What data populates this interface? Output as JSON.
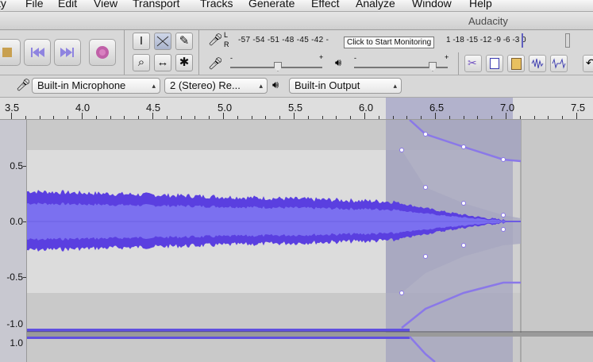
{
  "menubar": {
    "items": [
      "ty",
      "File",
      "Edit",
      "View",
      "Transport",
      "Tracks",
      "Generate",
      "Effect",
      "Analyze",
      "Window",
      "Help"
    ]
  },
  "window": {
    "title": "Audacity"
  },
  "meters": {
    "record_ticks": "-57 -54 -51 -48 -45 -42 -",
    "monitor_button": "Click to Start Monitoring",
    "right_ticks": "1 -18 -15 -12  -9   -6   -3   0",
    "record_channel_l": "L",
    "record_channel_r": "R"
  },
  "devices": {
    "input": "Built-in Microphone",
    "channels": "2 (Stereo) Re...",
    "output": "Built-in Output"
  },
  "ruler": {
    "labels": [
      "3.5",
      "4.0",
      "4.5",
      "5.0",
      "5.5",
      "6.0",
      "6.5",
      "7.0",
      "7.5"
    ]
  },
  "track": {
    "vertical_scale": [
      "0.5",
      "0.0",
      "-0.5",
      "-1.0",
      "1.0"
    ],
    "colors": {
      "waveform": "#5a3fe0",
      "waveform_rms": "#7b70f0",
      "envelope": "#8a78e8",
      "selection": "#a2a2bc"
    }
  }
}
